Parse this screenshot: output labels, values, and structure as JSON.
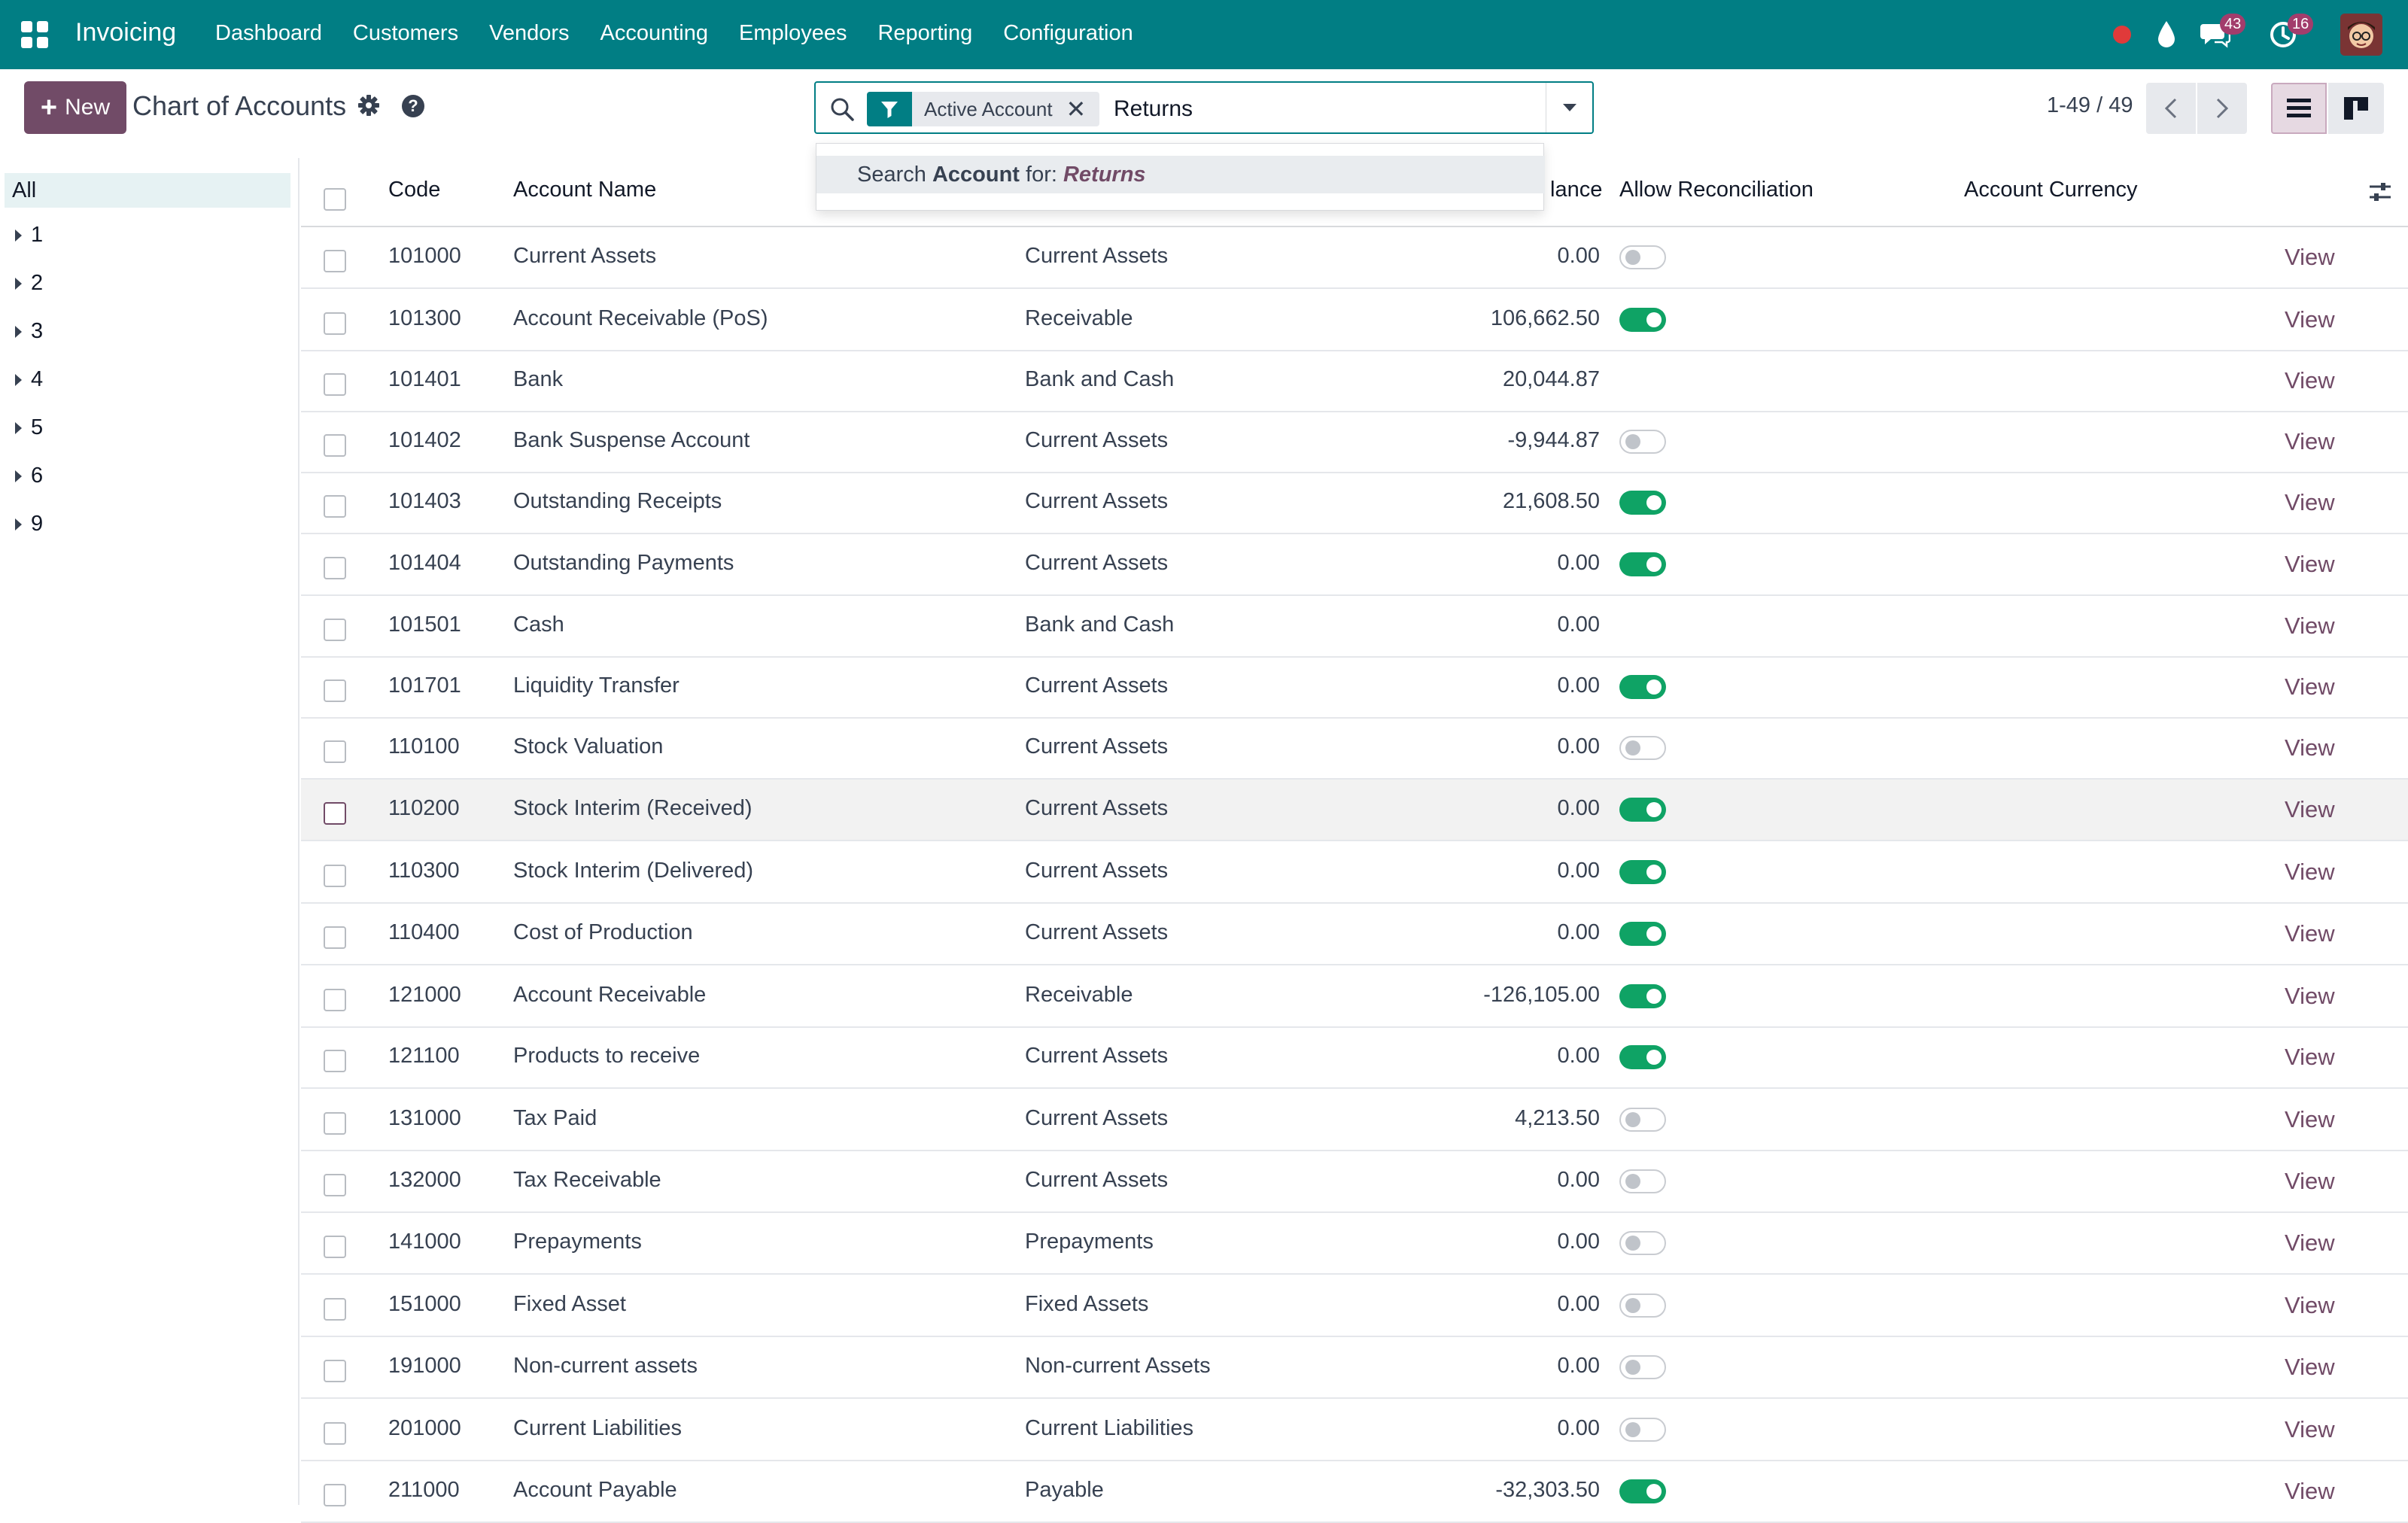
{
  "navbar": {
    "app_name": "Invoicing",
    "menu": [
      "Dashboard",
      "Customers",
      "Vendors",
      "Accounting",
      "Employees",
      "Reporting",
      "Configuration"
    ],
    "chat_count": "43",
    "activity_count": "16",
    "colors": {
      "navbar_bg": "#017e84",
      "badge": "#a23d6c",
      "recording": "#e03a3a"
    }
  },
  "control_panel": {
    "new_label": "New",
    "title": "Chart of Accounts",
    "search": {
      "facet_label": "Active Account",
      "query": "Returns",
      "dropdown_prefix": "Search ",
      "dropdown_field": "Account",
      "dropdown_mid": " for: ",
      "dropdown_value": "Returns"
    },
    "pager": "1-49 / 49"
  },
  "side_panel": {
    "all_label": "All",
    "groups": [
      "1",
      "2",
      "3",
      "4",
      "5",
      "6",
      "9"
    ]
  },
  "table": {
    "columns": {
      "code": "Code",
      "name": "Account Name",
      "balance_partial": "lance",
      "reconcile": "Allow Reconciliation",
      "currency": "Account Currency"
    },
    "view_label": "View",
    "rows": [
      {
        "code": "101000",
        "name": "Current Assets",
        "type": "Current Assets",
        "balance": "0.00",
        "reconcile": "off"
      },
      {
        "code": "101300",
        "name": "Account Receivable (PoS)",
        "type": "Receivable",
        "balance": "106,662.50",
        "reconcile": "on"
      },
      {
        "code": "101401",
        "name": "Bank",
        "type": "Bank and Cash",
        "balance": "20,044.87",
        "reconcile": "none"
      },
      {
        "code": "101402",
        "name": "Bank Suspense Account",
        "type": "Current Assets",
        "balance": "-9,944.87",
        "reconcile": "off"
      },
      {
        "code": "101403",
        "name": "Outstanding Receipts",
        "type": "Current Assets",
        "balance": "21,608.50",
        "reconcile": "on"
      },
      {
        "code": "101404",
        "name": "Outstanding Payments",
        "type": "Current Assets",
        "balance": "0.00",
        "reconcile": "on"
      },
      {
        "code": "101501",
        "name": "Cash",
        "type": "Bank and Cash",
        "balance": "0.00",
        "reconcile": "none"
      },
      {
        "code": "101701",
        "name": "Liquidity Transfer",
        "type": "Current Assets",
        "balance": "0.00",
        "reconcile": "on"
      },
      {
        "code": "110100",
        "name": "Stock Valuation",
        "type": "Current Assets",
        "balance": "0.00",
        "reconcile": "off"
      },
      {
        "code": "110200",
        "name": "Stock Interim (Received)",
        "type": "Current Assets",
        "balance": "0.00",
        "reconcile": "on"
      },
      {
        "code": "110300",
        "name": "Stock Interim (Delivered)",
        "type": "Current Assets",
        "balance": "0.00",
        "reconcile": "on"
      },
      {
        "code": "110400",
        "name": "Cost of Production",
        "type": "Current Assets",
        "balance": "0.00",
        "reconcile": "on"
      },
      {
        "code": "121000",
        "name": "Account Receivable",
        "type": "Receivable",
        "balance": "-126,105.00",
        "reconcile": "on"
      },
      {
        "code": "121100",
        "name": "Products to receive",
        "type": "Current Assets",
        "balance": "0.00",
        "reconcile": "on"
      },
      {
        "code": "131000",
        "name": "Tax Paid",
        "type": "Current Assets",
        "balance": "4,213.50",
        "reconcile": "off"
      },
      {
        "code": "132000",
        "name": "Tax Receivable",
        "type": "Current Assets",
        "balance": "0.00",
        "reconcile": "off"
      },
      {
        "code": "141000",
        "name": "Prepayments",
        "type": "Prepayments",
        "balance": "0.00",
        "reconcile": "off"
      },
      {
        "code": "151000",
        "name": "Fixed Asset",
        "type": "Fixed Assets",
        "balance": "0.00",
        "reconcile": "off"
      },
      {
        "code": "191000",
        "name": "Non-current assets",
        "type": "Non-current Assets",
        "balance": "0.00",
        "reconcile": "off"
      },
      {
        "code": "201000",
        "name": "Current Liabilities",
        "type": "Current Liabilities",
        "balance": "0.00",
        "reconcile": "off"
      },
      {
        "code": "211000",
        "name": "Account Payable",
        "type": "Payable",
        "balance": "-32,303.50",
        "reconcile": "on"
      }
    ]
  }
}
